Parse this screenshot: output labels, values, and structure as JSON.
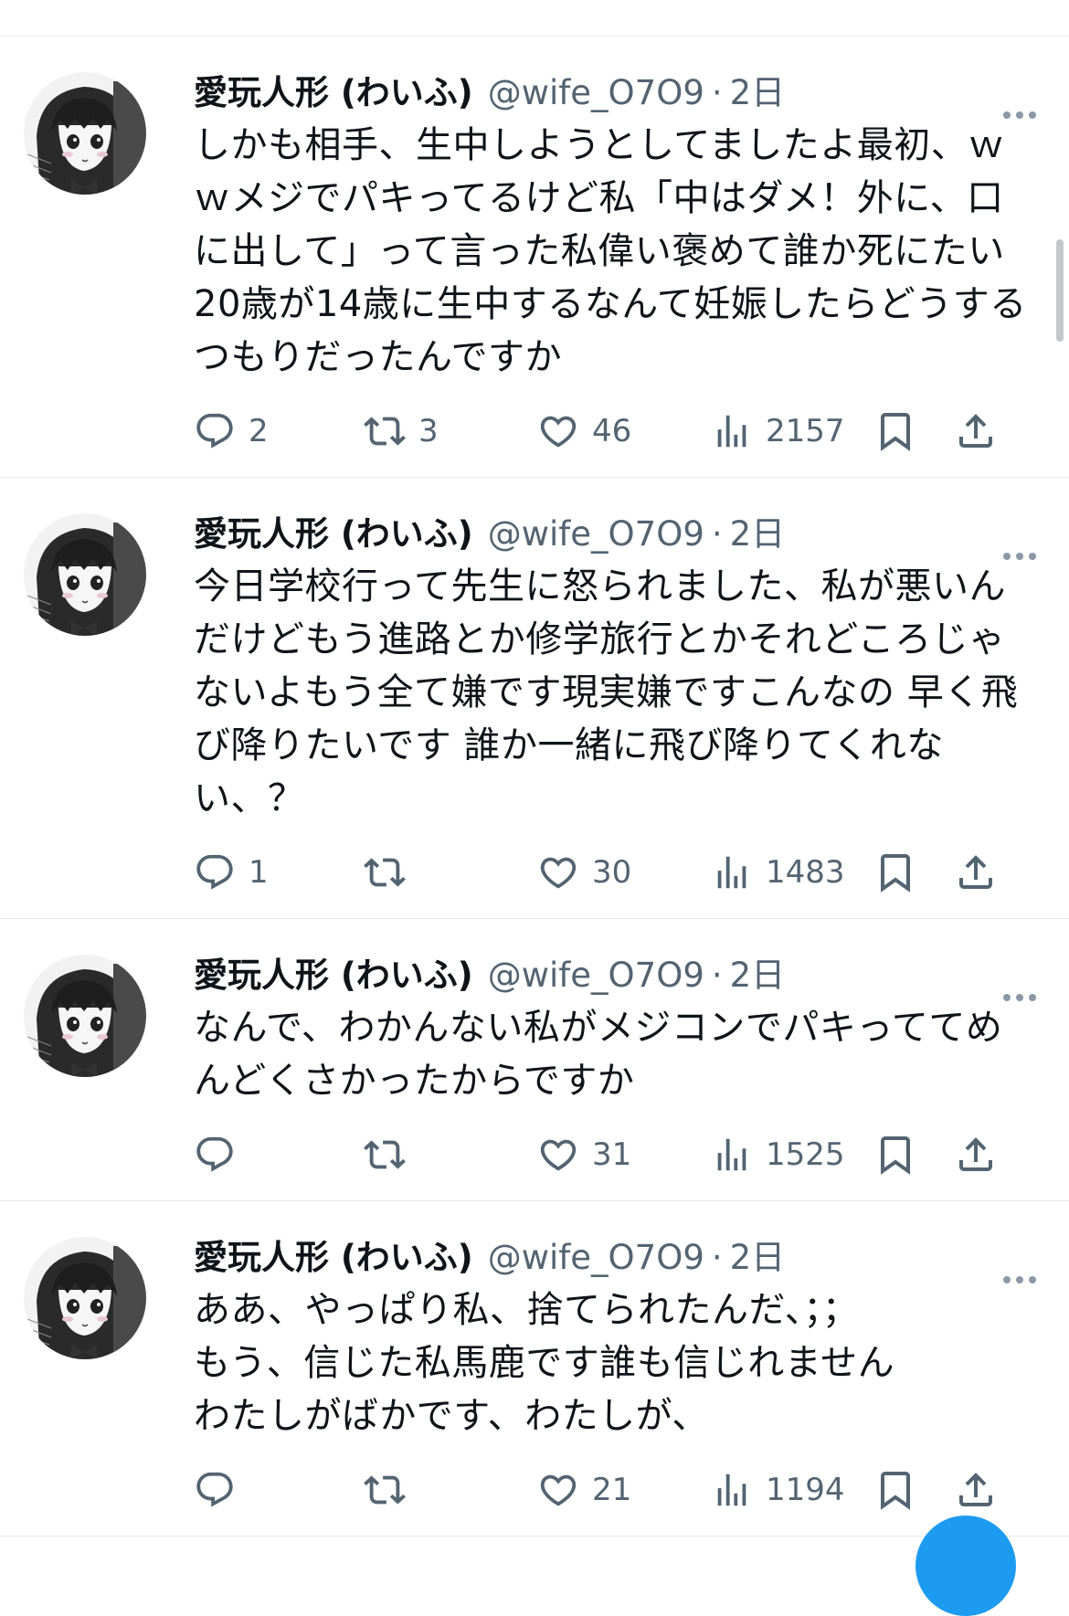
{
  "tweets": [
    {
      "display_name": "愛玩人形 (わいふ)",
      "handle": "@wife_O7O9",
      "time": "2日",
      "lines": [
        "しかも相手、生中しようとしてましたよ最初、ｗ",
        "ｗメジでパキってるけど私「中はダメ！外に、口",
        "に出して」って言った私偉い褒めて誰か死にたい",
        "20歳が14歳に生中するなんて妊娠したらどうする",
        "つもりだったんですか"
      ],
      "replies": "2",
      "retweets": "3",
      "likes": "46",
      "views": "2157"
    },
    {
      "display_name": "愛玩人形 (わいふ)",
      "handle": "@wife_O7O9",
      "time": "2日",
      "lines": [
        "今日学校行って先生に怒られました、私が悪いん",
        "だけどもう進路とか修学旅行とかそれどころじゃ",
        "ないよもう全て嫌です現実嫌ですこんなの 早く飛",
        "び降りたいです 誰か一緒に飛び降りてくれな",
        "い、？"
      ],
      "replies": "1",
      "retweets": "",
      "likes": "30",
      "views": "1483"
    },
    {
      "display_name": "愛玩人形 (わいふ)",
      "handle": "@wife_O7O9",
      "time": "2日",
      "lines": [
        "なんで、わかんない私がメジコンでパキっててめ",
        "んどくさかったからですか"
      ],
      "replies": "",
      "retweets": "",
      "likes": "31",
      "views": "1525"
    },
    {
      "display_name": "愛玩人形 (わいふ)",
      "handle": "@wife_O7O9",
      "time": "2日",
      "lines": [
        "ああ、やっぱり私、捨てられたんだ、；；",
        "もう、信じた私馬鹿です誰も信じれません",
        "わたしがばかです、わたしが、"
      ],
      "replies": "",
      "retweets": "",
      "likes": "21",
      "views": "1194"
    }
  ],
  "dot_separator": "·",
  "icons": {
    "reply": "reply-icon",
    "retweet": "retweet-icon",
    "like": "heart-icon",
    "views": "views-icon",
    "bookmark": "bookmark-icon",
    "share": "share-icon",
    "more": "more-icon"
  },
  "colors": {
    "text": "#0f1419",
    "secondary": "#536471",
    "divider": "#e6e9eb",
    "accent": "#1d9bf0"
  }
}
